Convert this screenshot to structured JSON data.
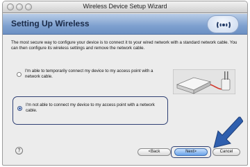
{
  "window": {
    "title": "Wireless Device Setup Wizard"
  },
  "header": {
    "title": "Setting Up Wireless"
  },
  "intro": {
    "text": "The most secure way to configure your device is to connect it to your wired network with a standard network cable. You can then configure its wireless settings and remove the network cable."
  },
  "options": [
    {
      "label": "I'm able to temporarily connect my device to my access point with a network cable.",
      "selected": false
    },
    {
      "label": "I'm not able to connect my device to my access point with a network cable.",
      "selected": true
    }
  ],
  "buttons": {
    "help": "?",
    "back": "<Back",
    "next": "Next>",
    "cancel": "Cancel"
  },
  "colors": {
    "header": "#7ea0cf",
    "accent": "#2e3f73",
    "arrow": "#2f5fae"
  }
}
